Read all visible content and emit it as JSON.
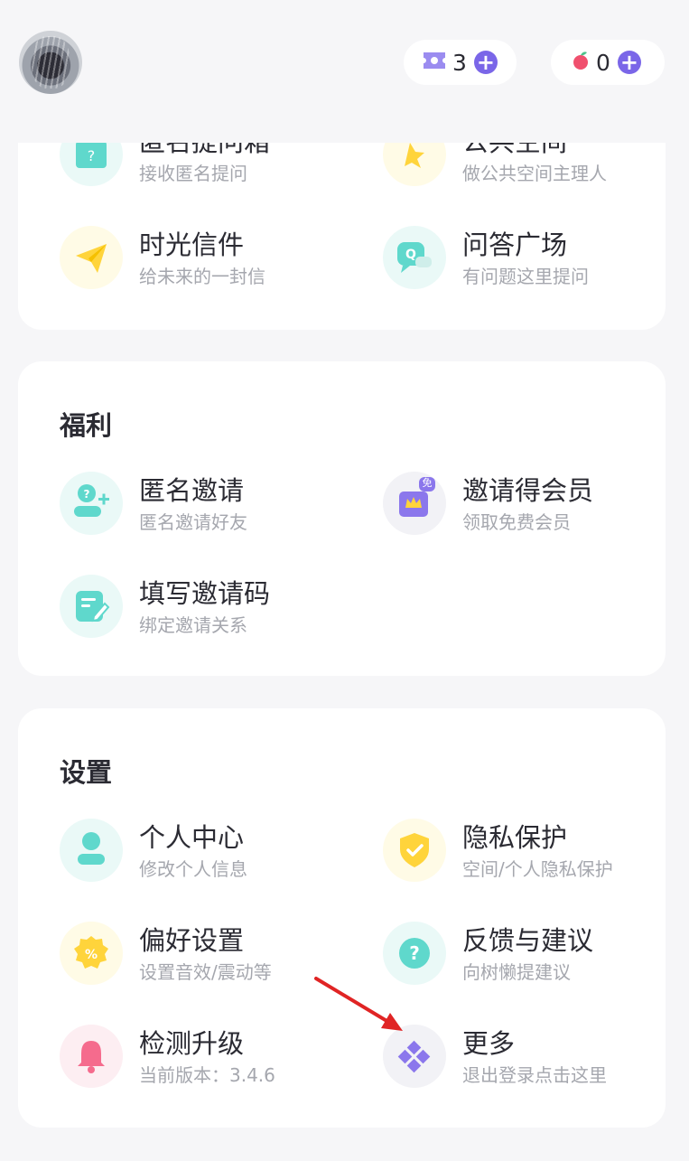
{
  "header": {
    "ticket_count": "3",
    "fruit_count": "0"
  },
  "top_card": {
    "items": [
      {
        "name": "匿名提问箱",
        "desc": "接收匿名提问"
      },
      {
        "name": "公共空间",
        "desc": "做公共空间主理人"
      },
      {
        "name": "时光信件",
        "desc": "给未来的一封信"
      },
      {
        "name": "问答广场",
        "desc": "有问题这里提问"
      }
    ]
  },
  "welfare": {
    "title": "福利",
    "items": [
      {
        "name": "匿名邀请",
        "desc": "匿名邀请好友"
      },
      {
        "name": "邀请得会员",
        "desc": "领取免费会员"
      },
      {
        "name": "填写邀请码",
        "desc": "绑定邀请关系"
      }
    ],
    "badge": "免"
  },
  "settings": {
    "title": "设置",
    "items": [
      {
        "name": "个人中心",
        "desc": "修改个人信息"
      },
      {
        "name": "隐私保护",
        "desc": "空间/个人隐私保护"
      },
      {
        "name": "偏好设置",
        "desc": "设置音效/震动等"
      },
      {
        "name": "反馈与建议",
        "desc": "向树懒提建议"
      },
      {
        "name": "检测升级",
        "desc": "当前版本：3.4.6"
      },
      {
        "name": "更多",
        "desc": "退出登录点击这里"
      }
    ]
  },
  "colors": {
    "accent": "#7a66e8",
    "annotation_arrow": "#e02424"
  }
}
